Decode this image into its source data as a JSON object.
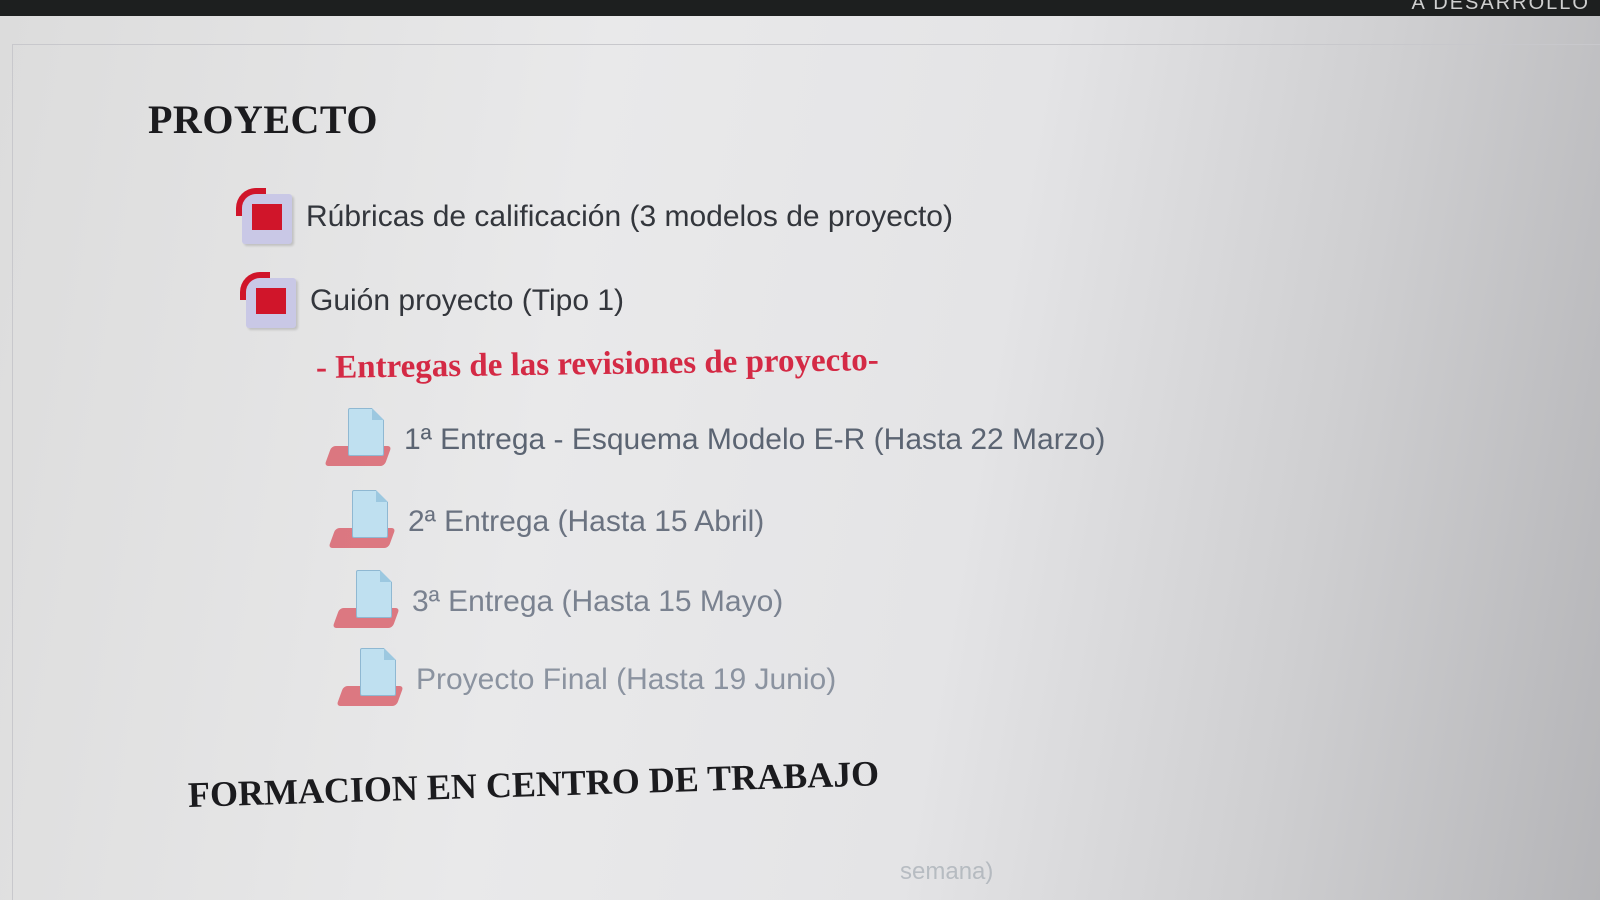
{
  "topbar": {
    "partial_text": "A DESARROLLO"
  },
  "sections": {
    "proyecto": {
      "title": "PROYECTO",
      "resources": [
        {
          "label": "Rúbricas de calificación (3 modelos de proyecto)",
          "icon": "pdf-icon"
        },
        {
          "label": "Guión proyecto (Tipo 1)",
          "icon": "pdf-icon"
        }
      ],
      "subheading": "- Entregas de las revisiones de proyecto-",
      "assignments": [
        {
          "label": "1ª Entrega - Esquema Modelo E-R (Hasta 22 Marzo)",
          "icon": "assignment-icon"
        },
        {
          "label": "2ª Entrega (Hasta 15 Abril)",
          "icon": "assignment-icon"
        },
        {
          "label": "3ª Entrega (Hasta 15 Mayo)",
          "icon": "assignment-icon"
        },
        {
          "label": "Proyecto Final (Hasta 19 Junio)",
          "icon": "assignment-icon"
        }
      ]
    },
    "fct": {
      "title": "FORMACION EN CENTRO DE TRABAJO",
      "partial_text": "semana)"
    }
  },
  "colors": {
    "subheading": "#d42a45",
    "pdf_red": "#d0152a",
    "title": "#1b1b1e"
  }
}
